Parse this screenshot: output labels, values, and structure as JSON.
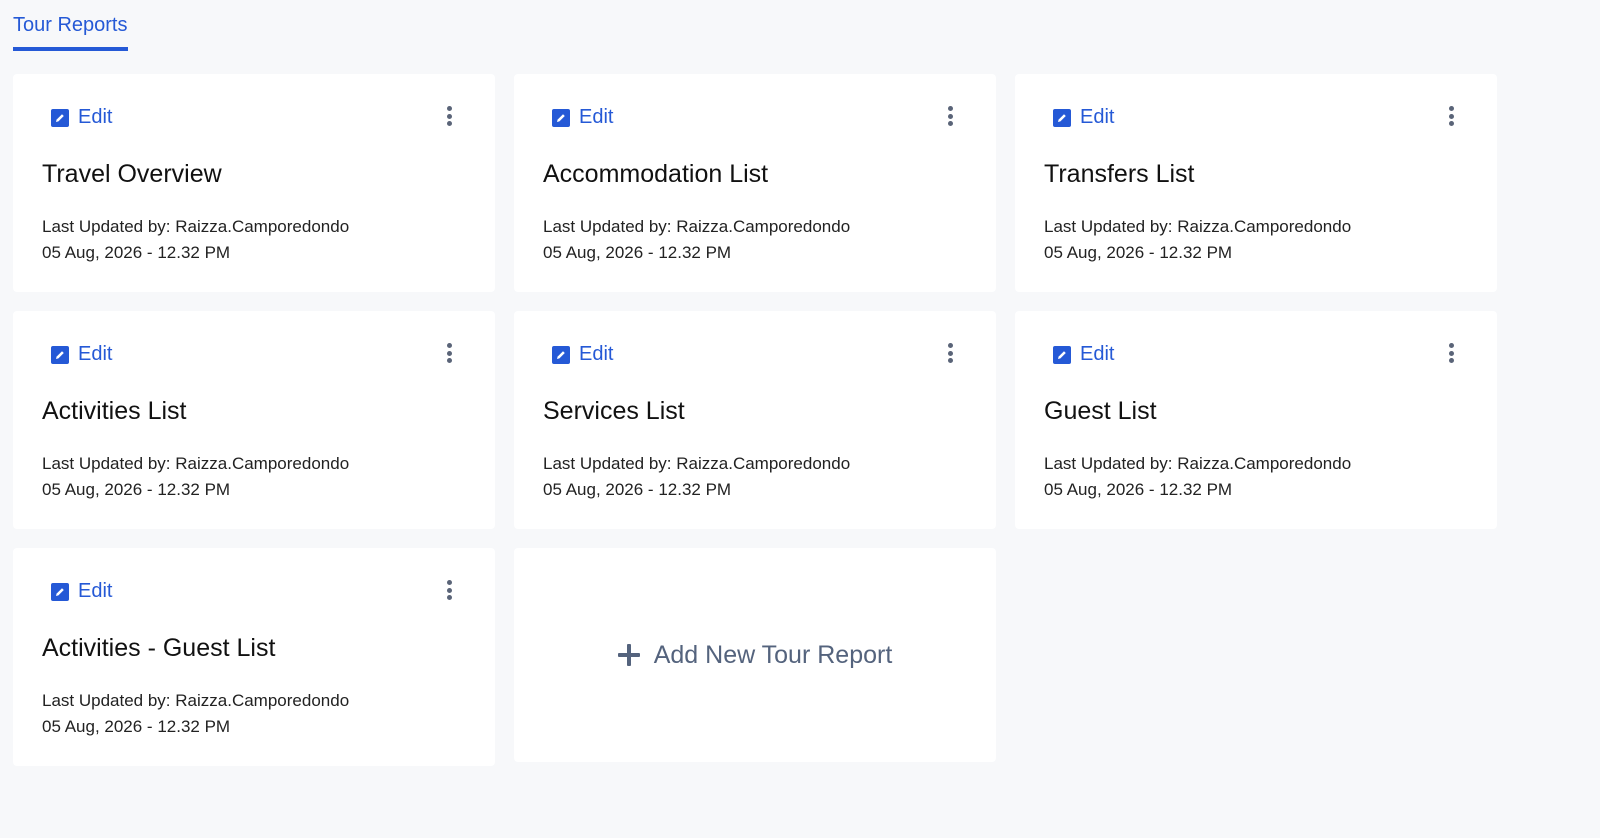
{
  "tabs": [
    {
      "label": "Tour Reports",
      "active": true
    }
  ],
  "colors": {
    "accent": "#2559d6",
    "background": "#f7f8fa",
    "card": "#ffffff",
    "muted": "#54637d"
  },
  "edit_label": "Edit",
  "last_updated_prefix": "Last Updated by:",
  "reports": [
    {
      "title": "Travel Overview",
      "updated_by": "Raizza.Camporedondo",
      "updated_at": "05 Aug, 2026 - 12.32 PM"
    },
    {
      "title": "Accommodation List",
      "updated_by": "Raizza.Camporedondo",
      "updated_at": "05 Aug, 2026 - 12.32 PM"
    },
    {
      "title": "Transfers List",
      "updated_by": "Raizza.Camporedondo",
      "updated_at": "05 Aug, 2026 - 12.32 PM"
    },
    {
      "title": "Activities List",
      "updated_by": "Raizza.Camporedondo",
      "updated_at": "05 Aug, 2026 - 12.32 PM"
    },
    {
      "title": "Services List",
      "updated_by": "Raizza.Camporedondo",
      "updated_at": "05 Aug, 2026 - 12.32 PM"
    },
    {
      "title": "Guest List",
      "updated_by": "Raizza.Camporedondo",
      "updated_at": "05 Aug, 2026 - 12.32 PM"
    },
    {
      "title": "Activities - Guest List",
      "updated_by": "Raizza.Camporedondo",
      "updated_at": "05 Aug, 2026 - 12.32 PM"
    }
  ],
  "add_new": {
    "label": "Add New Tour Report",
    "icon": "plus-icon"
  },
  "icons": {
    "edit": "edit-icon",
    "more": "more-vertical-icon"
  }
}
